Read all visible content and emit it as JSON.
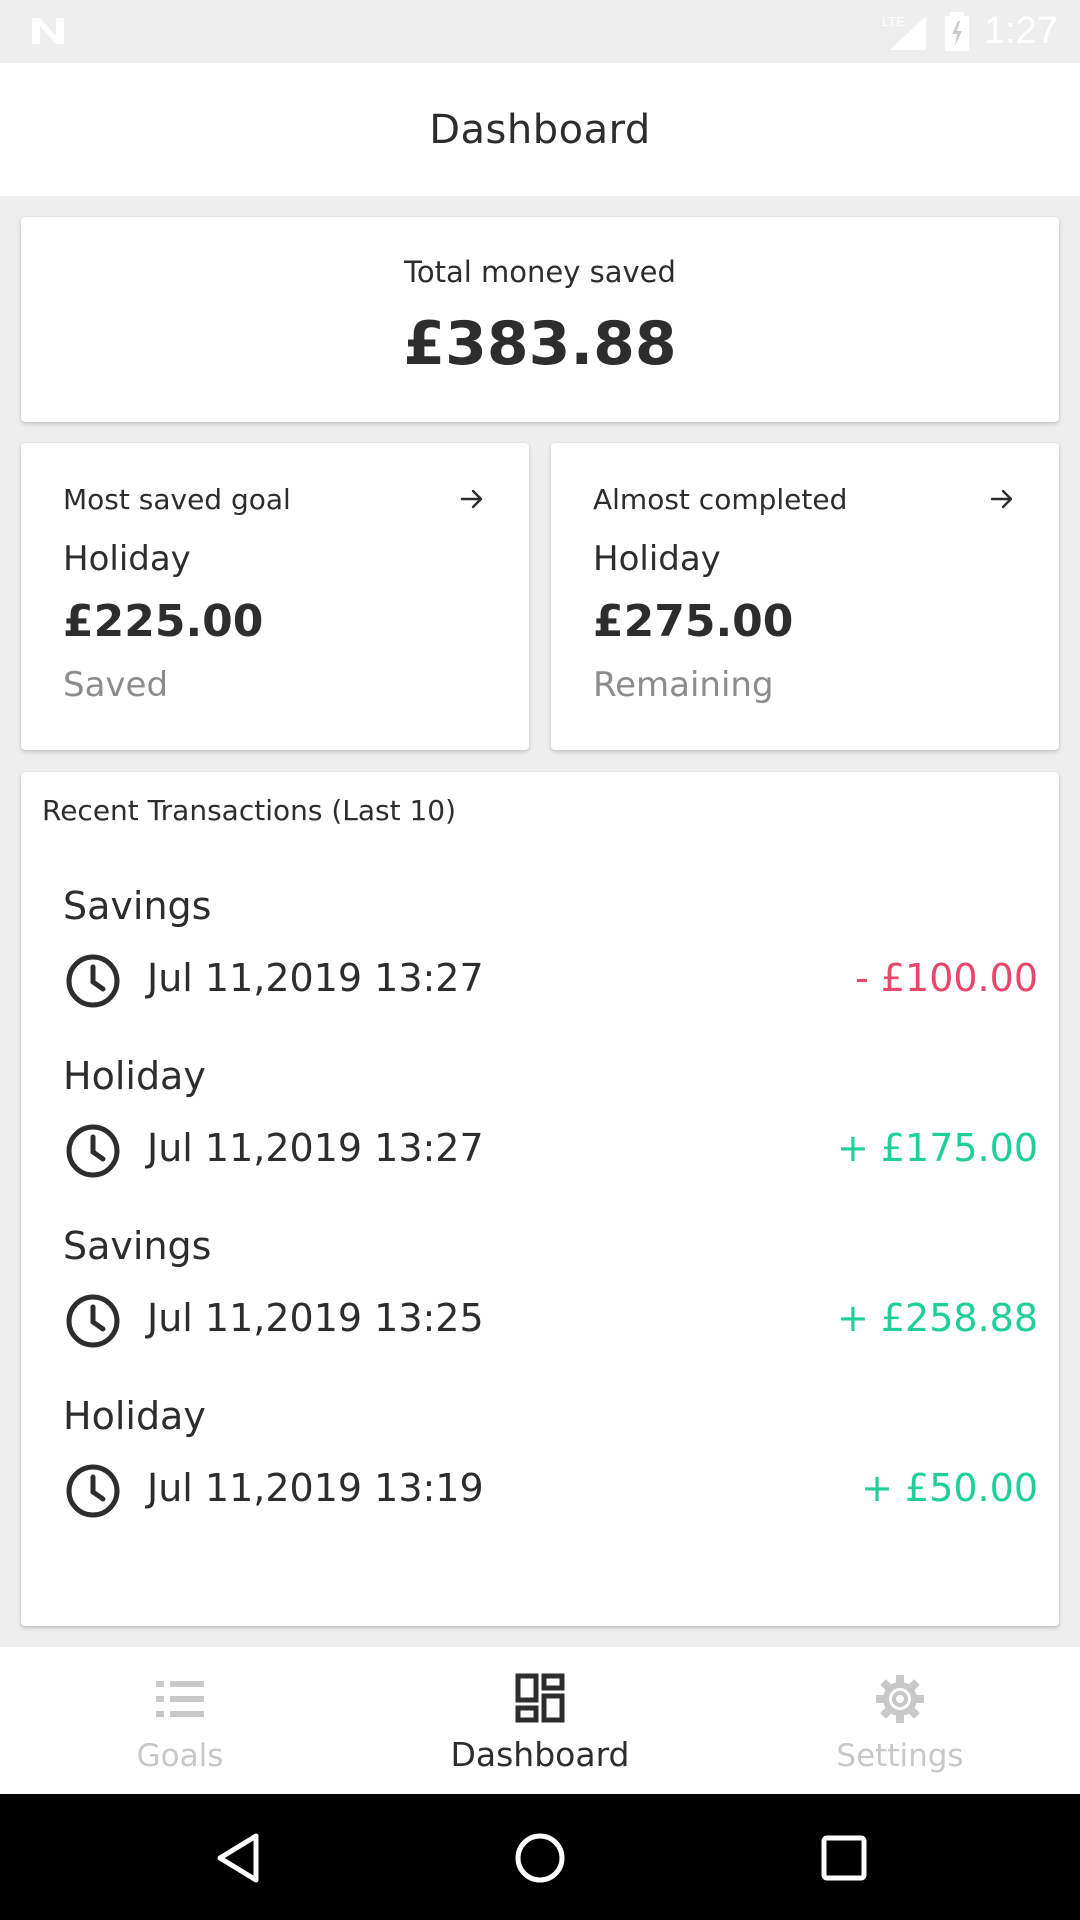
{
  "status_bar": {
    "network": "LTE",
    "time": "1:27"
  },
  "app_bar": {
    "title": "Dashboard"
  },
  "total": {
    "label": "Total money saved",
    "value": "£383.88"
  },
  "goals": [
    {
      "label": "Most saved goal",
      "name": "Holiday",
      "amount": "£225.00",
      "status": "Saved"
    },
    {
      "label": "Almost completed",
      "name": "Holiday",
      "amount": "£275.00",
      "status": "Remaining"
    }
  ],
  "transactions": {
    "header": "Recent Transactions (Last 10)",
    "items": [
      {
        "name": "Savings",
        "date": "Jul 11,2019 13:27",
        "amount": "- £100.00",
        "type": "negative"
      },
      {
        "name": "Holiday",
        "date": "Jul 11,2019 13:27",
        "amount": "+ £175.00",
        "type": "positive"
      },
      {
        "name": "Savings",
        "date": "Jul 11,2019 13:25",
        "amount": "+ £258.88",
        "type": "positive"
      },
      {
        "name": "Holiday",
        "date": "Jul 11,2019 13:19",
        "amount": "+ £50.00",
        "type": "positive"
      }
    ]
  },
  "bottom_nav": {
    "items": [
      {
        "label": "Goals",
        "icon": "list-icon",
        "active": false
      },
      {
        "label": "Dashboard",
        "icon": "dashboard-icon",
        "active": true
      },
      {
        "label": "Settings",
        "icon": "gear-icon",
        "active": false
      }
    ]
  },
  "colors": {
    "negative": "#e8476b",
    "positive": "#1fcf9a",
    "text": "#2d2d2d",
    "muted": "#8c8c8c",
    "inactive": "#c8c8c8"
  }
}
